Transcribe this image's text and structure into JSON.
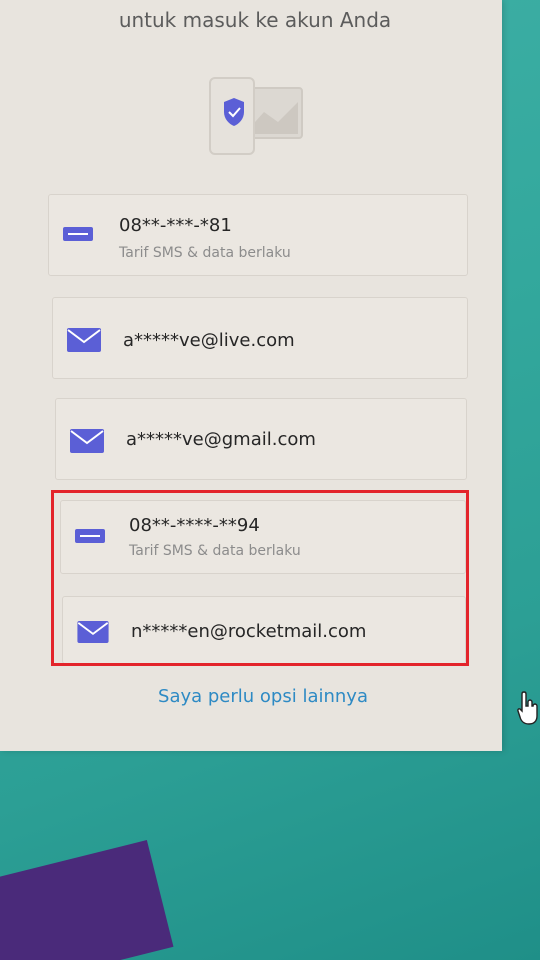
{
  "header": {
    "subtitle": "untuk masuk ke akun Anda"
  },
  "options": [
    {
      "type": "sms",
      "icon": "sms-icon",
      "primary": "08**-***-*81",
      "secondary": "Tarif SMS & data berlaku"
    },
    {
      "type": "email",
      "icon": "envelope-icon",
      "primary": "a*****ve@live.com"
    },
    {
      "type": "email",
      "icon": "envelope-icon",
      "primary": "a*****ve@gmail.com"
    },
    {
      "type": "sms",
      "icon": "sms-icon",
      "primary": "08**-****-**94",
      "secondary": "Tarif SMS & data berlaku"
    },
    {
      "type": "email",
      "icon": "envelope-icon",
      "primary": "n*****en@rocketmail.com"
    }
  ],
  "more_link": "Saya perlu opsi lainnya",
  "colors": {
    "accent": "#5b5fd6",
    "link": "#2e8ac4",
    "highlight": "#e3242b",
    "background": "#33a89d"
  }
}
